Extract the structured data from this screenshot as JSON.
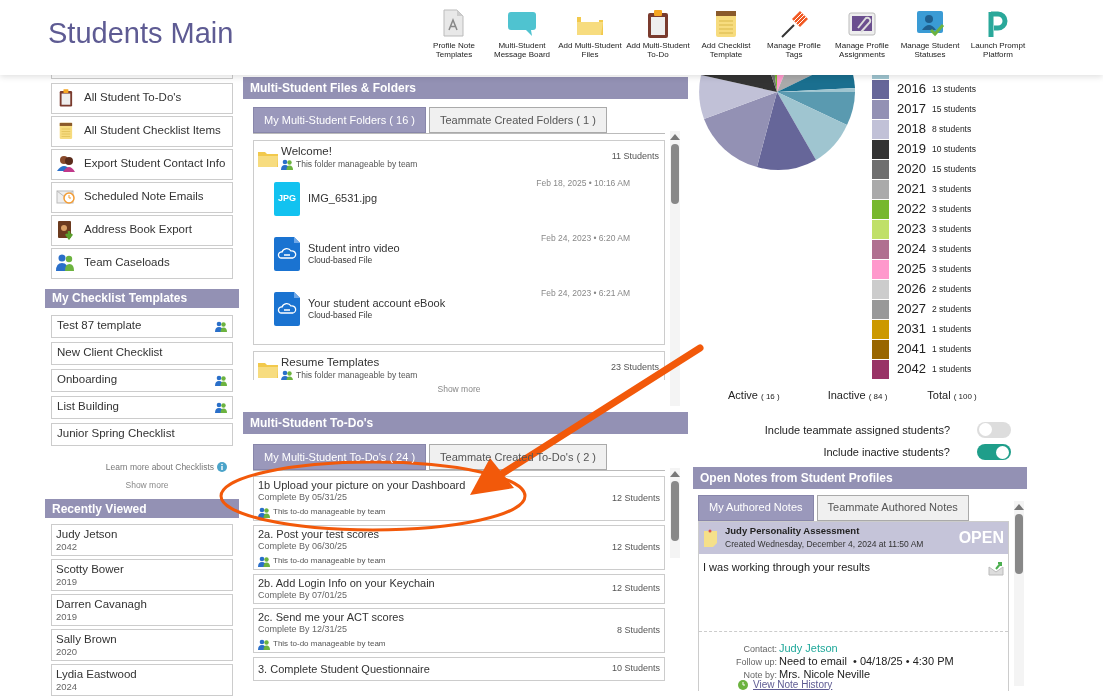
{
  "header": {
    "title": "Students Main",
    "tools": [
      {
        "label": "Profile Note Templates",
        "kind": "document"
      },
      {
        "label": "Multi-Student Message Board",
        "kind": "chat"
      },
      {
        "label": "Add Multi-Student Files",
        "kind": "folder"
      },
      {
        "label": "Add Multi-Student To-Do",
        "kind": "clipboard"
      },
      {
        "label": "Add Checklist Template",
        "kind": "notepad"
      },
      {
        "label": "Manage Profile Tags",
        "kind": "pin"
      },
      {
        "label": "Manage Profile Assignments",
        "kind": "paperclip"
      },
      {
        "label": "Manage Student Statuses",
        "kind": "person"
      },
      {
        "label": "Launch Prompt Platform",
        "kind": "prompt"
      }
    ]
  },
  "sidebar": {
    "actions": [
      {
        "label": "All Student To-Do's",
        "kind": "clipboard"
      },
      {
        "label": "All Student Checklist Items",
        "kind": "notepad"
      },
      {
        "label": "Export Student Contact Info",
        "kind": "contacts"
      },
      {
        "label": "Scheduled Note Emails",
        "kind": "mail"
      },
      {
        "label": "Address Book Export",
        "kind": "book"
      },
      {
        "label": "Team Caseloads",
        "kind": "team"
      }
    ],
    "checklist_templates": {
      "title": "My Checklist Templates",
      "items": [
        {
          "label": "Test 87 template",
          "shared": true
        },
        {
          "label": "New Client Checklist",
          "shared": false
        },
        {
          "label": "Onboarding",
          "shared": true
        },
        {
          "label": "List Building",
          "shared": true
        },
        {
          "label": "Junior Spring Checklist",
          "shared": false
        }
      ],
      "learn_more": "Learn more about Checklists",
      "show_more": "Show more"
    },
    "recently_viewed": {
      "title": "Recently Viewed",
      "items": [
        {
          "name": "Judy Jetson",
          "year": "2042"
        },
        {
          "name": "Scotty Bower",
          "year": "2019"
        },
        {
          "name": "Darren Cavanagh",
          "year": "2019"
        },
        {
          "name": "Sally Brown",
          "year": "2020"
        },
        {
          "name": "Lydia Eastwood",
          "year": "2024"
        }
      ]
    }
  },
  "files": {
    "title": "Multi-Student Files & Folders",
    "tabs": [
      {
        "label": "My Multi-Student Folders ( 16 )",
        "selected": true
      },
      {
        "label": "Teammate Created Folders ( 1 )",
        "selected": false
      }
    ],
    "folders": [
      {
        "name": "Welcome!",
        "note": "This folder manageable by team",
        "count": "11 Students",
        "files": [
          {
            "name": "IMG_6531.jpg",
            "kind": "jpg",
            "badge": "JPG",
            "date": "Feb 18, 2025 • 10:16 AM"
          },
          {
            "name": "Student intro video",
            "kind": "cloud",
            "subtitle": "Cloud-based File",
            "date": "Feb 24, 2023 • 6:20 AM"
          },
          {
            "name": "Your student account eBook",
            "kind": "cloud",
            "subtitle": "Cloud-based File",
            "date": "Feb 24, 2023 • 6:21 AM"
          }
        ]
      },
      {
        "name": "Resume Templates",
        "note": "This folder manageable by team",
        "count": "23 Students"
      }
    ],
    "show_more": "Show more"
  },
  "todos": {
    "title": "Multi-Student To-Do's",
    "tabs": [
      {
        "label": "My Multi-Student To-Do's ( 24 )",
        "selected": true
      },
      {
        "label": "Teammate Created To-Do's ( 2 )",
        "selected": false
      }
    ],
    "items": [
      {
        "title": "1b Upload your picture on your Dashboard",
        "due": "Complete By 05/31/25",
        "count": "12 Students",
        "note": "This to-do manageable by team"
      },
      {
        "title": "2a. Post your test scores",
        "due": "Complete By 06/30/25",
        "count": "12 Students",
        "note": "This to-do manageable by team"
      },
      {
        "title": "2b. Add Login Info on your Keychain",
        "due": "Complete By 07/01/25",
        "count": "12 Students"
      },
      {
        "title": "2c. Send me your ACT scores",
        "due": "Complete By 12/31/25",
        "count": "8 Students",
        "note": "This to-do manageable by team"
      },
      {
        "title": "3. Complete Student Questionnaire",
        "count": "10 Students"
      }
    ]
  },
  "graduation_years": {
    "legend": [
      {
        "year": "2016",
        "count": "13 students",
        "color": "#666699"
      },
      {
        "year": "2017",
        "count": "15 students",
        "color": "#9391b4"
      },
      {
        "year": "2018",
        "count": "8 students",
        "color": "#c1c1d7"
      },
      {
        "year": "2019",
        "count": "10 students",
        "color": "#333333"
      },
      {
        "year": "2020",
        "count": "15 students",
        "color": "#6f6f6f"
      },
      {
        "year": "2021",
        "count": "3 students",
        "color": "#aaaaaa"
      },
      {
        "year": "2022",
        "count": "3 students",
        "color": "#77b82e"
      },
      {
        "year": "2023",
        "count": "3 students",
        "color": "#c0e068"
      },
      {
        "year": "2024",
        "count": "3 students",
        "color": "#b07090"
      },
      {
        "year": "2025",
        "count": "3 students",
        "color": "#ff99cc"
      },
      {
        "year": "2026",
        "count": "2 students",
        "color": "#cccccc"
      },
      {
        "year": "2027",
        "count": "2 students",
        "color": "#999999"
      },
      {
        "year": "2031",
        "count": "1 students",
        "color": "#cc9900"
      },
      {
        "year": "2041",
        "count": "1 students",
        "color": "#996600"
      },
      {
        "year": "2042",
        "count": "1 students",
        "color": "#993366"
      }
    ],
    "totals": [
      {
        "label": "Active",
        "count": "( 16 )"
      },
      {
        "label": "Inactive",
        "count": "( 84 )"
      },
      {
        "label": "Total",
        "count": "( 100 )"
      }
    ],
    "toggles": [
      {
        "label": "Include teammate assigned students?",
        "on": false
      },
      {
        "label": "Include inactive students?",
        "on": true
      }
    ]
  },
  "notes": {
    "title": "Open Notes from Student Profiles",
    "tabs": [
      {
        "label": "My Authored Notes",
        "selected": true
      },
      {
        "label": "Teammate Authored Notes",
        "selected": false
      }
    ],
    "note": {
      "title": "Judy Personality Assessment",
      "created": "Created Wednesday, December 4, 2024 at 11:50 AM",
      "status": "OPEN",
      "body": "I was working through your results",
      "fields": [
        {
          "label": "Contact:",
          "value": "Judy Jetson",
          "kind": "link"
        },
        {
          "label": "Follow up:",
          "value": "Need to email  • 04/18/25 • 4:30 PM",
          "kind": "text"
        },
        {
          "label": "Note by:",
          "value": "Mrs. Nicole Neville",
          "kind": "text"
        }
      ],
      "history": "View Note History"
    }
  }
}
